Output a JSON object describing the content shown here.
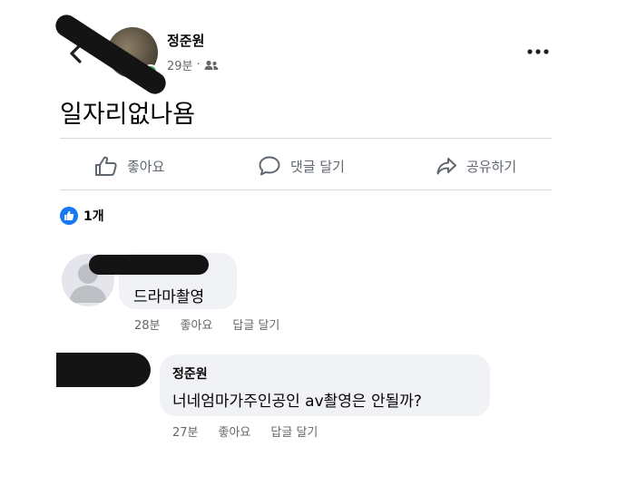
{
  "post": {
    "author_name": "정준원",
    "time": "29분",
    "separator": "·",
    "privacy_icon": "friends-icon",
    "text": "일자리없나욤"
  },
  "actions": {
    "like": "좋아요",
    "comment": "댓글 달기",
    "share": "공유하기"
  },
  "reactions": {
    "count": "1개",
    "icon": "like-icon",
    "color": "#1877f2"
  },
  "comments": [
    {
      "author_name": "",
      "text": "드라마촬영",
      "time": "28분",
      "like_label": "좋아요",
      "reply_label": "답글 달기"
    },
    {
      "author_name": "정준원",
      "text": "너네엄마가주인공인 av촬영은 안될까?",
      "time": "27분",
      "like_label": "좋아요",
      "reply_label": "답글 달기"
    }
  ],
  "colors": {
    "accent": "#1877f2",
    "secondary_text": "#65676b",
    "bubble": "#f0f2f5",
    "online": "#31a24c"
  }
}
